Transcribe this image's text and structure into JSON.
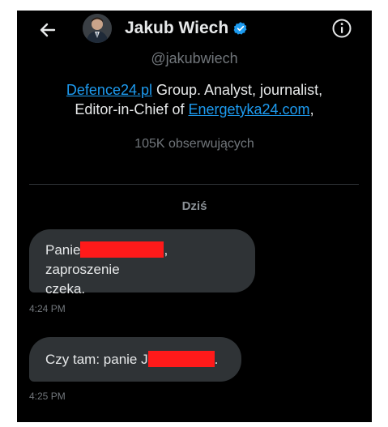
{
  "header": {
    "name": "Jakub Wiech",
    "verified_color": "#1d9bf0",
    "back_icon": "arrow-left-icon",
    "info_icon": "info-circle-icon"
  },
  "profile": {
    "handle": "@jakubwiech",
    "bio_link1": "Defence24.pl",
    "bio_text1": " Group. Analyst, journalist,",
    "bio_text2": "Editor-in-Chief of ",
    "bio_link2": "Energetyka24.com",
    "bio_text3": ",",
    "followers": "105K obserwujących"
  },
  "conversation": {
    "date_label": "Dziś",
    "messages": [
      {
        "part1": "Panie",
        "part2": ", zaproszenie",
        "part3": "czeka.",
        "time": "4:24 PM"
      },
      {
        "part1": "Czy tam: panie J",
        "part2": ".",
        "time": "4:25 PM"
      }
    ]
  },
  "colors": {
    "background": "#000000",
    "bubble": "#2f3336",
    "link": "#1d9bf0",
    "redaction": "#ff1a1a"
  }
}
